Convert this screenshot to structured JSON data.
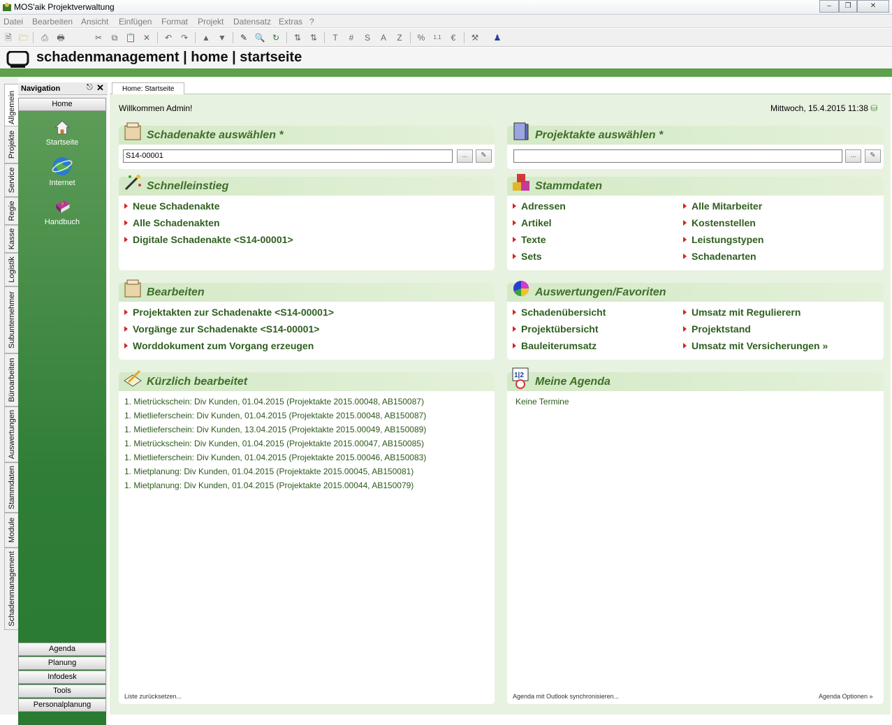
{
  "window": {
    "title": "MOS'aik Projektverwaltung"
  },
  "menu": [
    "Datei",
    "Bearbeiten",
    "Ansicht",
    "Einfügen",
    "Format",
    "Projekt",
    "Datensatz",
    "Extras",
    "?"
  ],
  "header": {
    "title": "schadenmanagement | home | startseite"
  },
  "left_tabs": [
    "Allgemein",
    "Projekte",
    "Service",
    "Regie",
    "Kasse",
    "Logistik",
    "Subunternehmer",
    "Büroarbeiten",
    "Auswertungen",
    "Stammdaten",
    "Module",
    "Schadenmanagement"
  ],
  "nav": {
    "title": "Navigation",
    "home": "Home",
    "items": [
      {
        "label": "Startseite",
        "icon": "house-icon"
      },
      {
        "label": "Internet",
        "icon": "globe-icon"
      },
      {
        "label": "Handbuch",
        "icon": "book-icon"
      }
    ],
    "bottom": [
      "Agenda",
      "Planung",
      "Infodesk",
      "Tools",
      "Personalplanung"
    ]
  },
  "doc_tab": "Home: Startseite",
  "welcome": "Willkommen Admin!",
  "datetime": "Mittwoch, 15.4.2015 11:38",
  "schadenakte": {
    "title": "Schadenakte auswählen *",
    "value": "S14-00001",
    "btn": "..."
  },
  "projektakte": {
    "title": "Projektakte auswählen *",
    "value": "",
    "btn": "..."
  },
  "schnelleinstieg": {
    "title": "Schnelleinstieg",
    "links": [
      "Neue Schadenakte",
      "Alle Schadenakten",
      "Digitale Schadenakte <S14-00001>"
    ]
  },
  "stammdaten": {
    "title": "Stammdaten",
    "left": [
      "Adressen",
      "Artikel",
      "Texte",
      "Sets"
    ],
    "right": [
      "Alle Mitarbeiter",
      "Kostenstellen",
      "Leistungstypen",
      "Schadenarten"
    ]
  },
  "bearbeiten": {
    "title": "Bearbeiten",
    "links": [
      "Projektakten zur Schadenakte <S14-00001>",
      "Vorgänge zur Schadenakte <S14-00001>",
      "Worddokument zum Vorgang erzeugen"
    ]
  },
  "auswertungen": {
    "title": "Auswertungen/Favoriten",
    "left": [
      "Schadenübersicht",
      "Projektübersicht",
      "Bauleiterumsatz"
    ],
    "right": [
      "Umsatz mit Regulierern",
      "Projektstand",
      "Umsatz mit Versicherungen »"
    ]
  },
  "kuerzlich": {
    "title": "Kürzlich bearbeitet",
    "items": [
      "1. Mietrückschein: Div Kunden, 01.04.2015 (Projektakte 2015.00048, AB150087)",
      "1. Mietlieferschein: Div Kunden, 01.04.2015 (Projektakte 2015.00048, AB150087)",
      "1. Mietlieferschein: Div Kunden, 13.04.2015 (Projektakte 2015.00049, AB150089)",
      "1. Mietrückschein: Div Kunden, 01.04.2015 (Projektakte 2015.00047, AB150085)",
      "1. Mietlieferschein: Div Kunden, 01.04.2015 (Projektakte 2015.00046, AB150083)",
      "1. Mietplanung: Div Kunden, 01.04.2015 (Projektakte 2015.00045, AB150081)",
      "1. Mietplanung: Div Kunden, 01.04.2015 (Projektakte 2015.00044, AB150079)"
    ],
    "reset": "Liste zurücksetzen..."
  },
  "agenda": {
    "title": "Meine Agenda",
    "empty": "Keine Termine",
    "sync": "Agenda mit Outlook synchronisieren...",
    "options": "Agenda Optionen »"
  }
}
